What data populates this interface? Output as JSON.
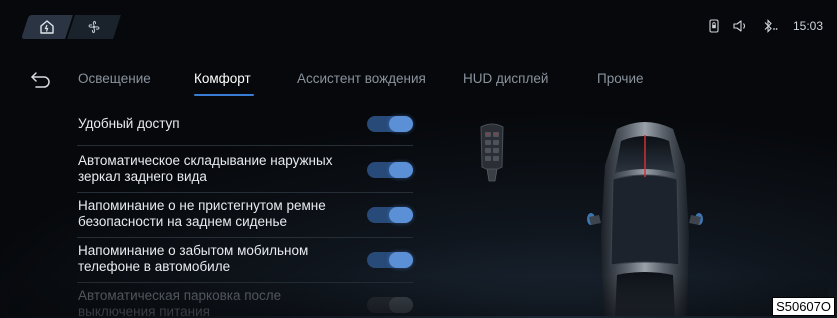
{
  "status": {
    "time": "15:03",
    "icons": [
      "home-ev-icon",
      "fan-icon",
      "phone-lock-icon",
      "volume-icon",
      "bluetooth-icon"
    ]
  },
  "tabs": [
    {
      "label": "Освещение",
      "active": false
    },
    {
      "label": "Комфорт",
      "active": true
    },
    {
      "label": "Ассистент вождения",
      "active": false
    },
    {
      "label": "HUD дисплей",
      "active": false
    },
    {
      "label": "Прочие",
      "active": false
    }
  ],
  "settings": [
    {
      "label": "Удобный доступ",
      "enabled": true
    },
    {
      "label": "Автоматическое складывание наружных зеркал заднего вида",
      "enabled": true
    },
    {
      "label": "Напоминание о не пристегнутом ремне безопасности на заднем сиденье",
      "enabled": true
    },
    {
      "label": "Напоминание о забытом мобильном телефоне в автомобиле",
      "enabled": true
    },
    {
      "label": "Автоматическая парковка после выключения питания",
      "enabled": true
    }
  ],
  "figure_code": "S50607O",
  "colors": {
    "accent": "#3a7bd5",
    "toggle_on": "#5b8fd6"
  }
}
